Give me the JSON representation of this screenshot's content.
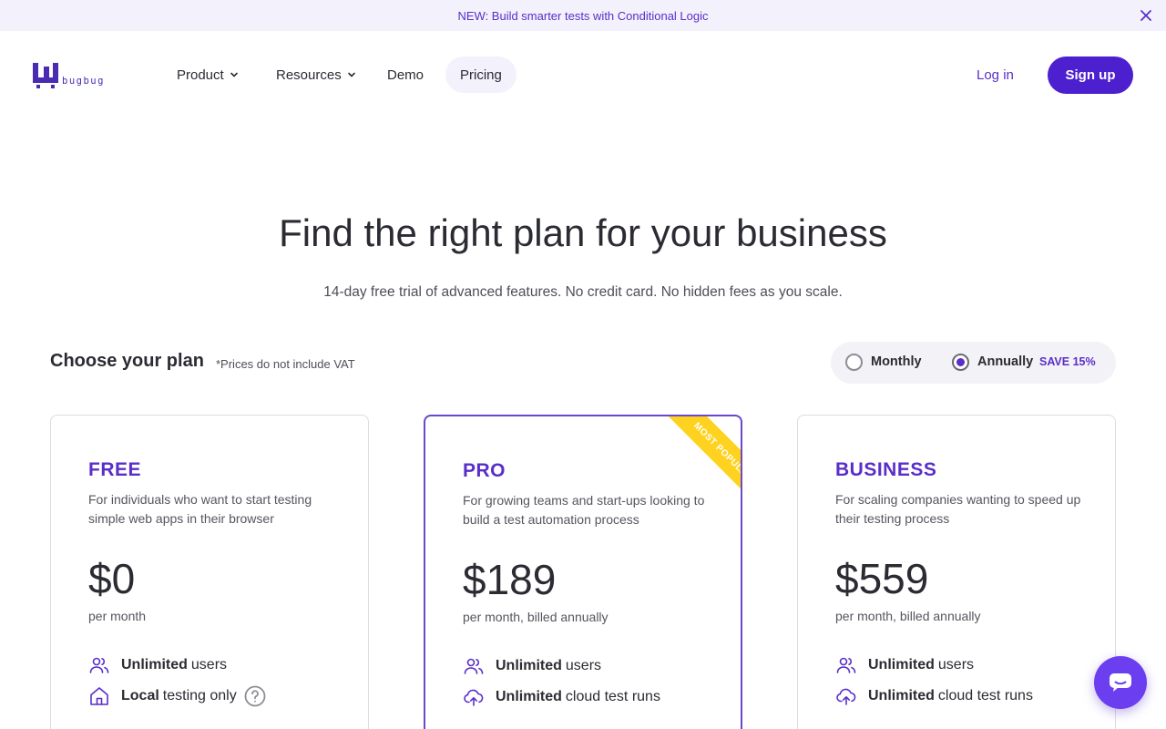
{
  "banner": {
    "text": "NEW: Build smarter tests with Conditional Logic",
    "close_icon": "close-icon"
  },
  "header": {
    "logo_text": "bugbug",
    "nav": [
      {
        "label": "Product",
        "has_dropdown": true
      },
      {
        "label": "Resources",
        "has_dropdown": true
      },
      {
        "label": "Demo",
        "has_dropdown": false
      },
      {
        "label": "Pricing",
        "has_dropdown": false,
        "active": true
      }
    ],
    "login_label": "Log in",
    "signup_label": "Sign up"
  },
  "hero": {
    "title": "Find the right plan for your business",
    "subtitle": "14-day free trial of advanced features. No credit card. No hidden fees as you scale."
  },
  "plans_header": {
    "title": "Choose your plan",
    "note": "*Prices do not include VAT",
    "billing": {
      "monthly_label": "Monthly",
      "annually_label": "Annually",
      "save_label": "SAVE 15%",
      "selected": "Annually"
    }
  },
  "plans": [
    {
      "name": "FREE",
      "description": "For individuals who want to start testing simple web apps in their browser",
      "price": "$0",
      "period": "per month",
      "featured": false,
      "features": [
        {
          "bold": "Unlimited",
          "rest": "users",
          "icon": "users-icon"
        },
        {
          "bold": "Local",
          "rest": "testing only",
          "icon": "home-icon",
          "help": true
        }
      ]
    },
    {
      "name": "PRO",
      "description": "For growing teams and start-ups looking to build a test automation process",
      "price": "$189",
      "period": "per month, billed annually",
      "featured": true,
      "ribbon": "MOST POPULAR",
      "features": [
        {
          "bold": "Unlimited",
          "rest": "users",
          "icon": "users-icon"
        },
        {
          "bold": "Unlimited",
          "rest": "cloud test runs",
          "icon": "cloud-upload-icon"
        }
      ]
    },
    {
      "name": "BUSINESS",
      "description": "For scaling companies wanting to speed up their testing process",
      "price": "$559",
      "period": "per month, billed annually",
      "featured": false,
      "features": [
        {
          "bold": "Unlimited",
          "rest": "users",
          "icon": "users-icon"
        },
        {
          "bold": "Unlimited",
          "rest": "cloud test runs",
          "icon": "cloud-upload-icon"
        }
      ]
    }
  ],
  "colors": {
    "brand": "#4c1fcf",
    "accent": "#5a2ec9",
    "ribbon": "#ffd21f",
    "banner_bg": "#f3f1fb"
  },
  "chat": {
    "icon": "chat-icon"
  }
}
